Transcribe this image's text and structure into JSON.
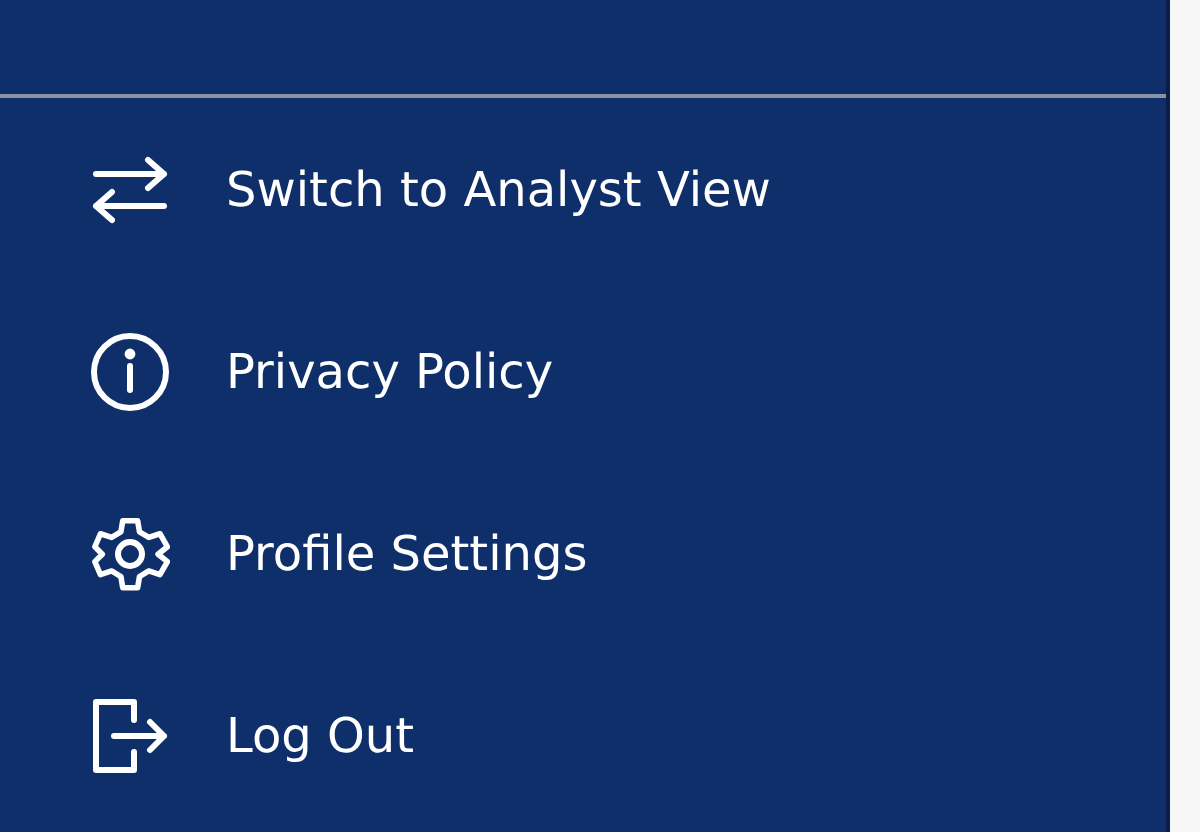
{
  "menu": {
    "items": [
      {
        "kind": "switch",
        "label": "Switch to Analyst View"
      },
      {
        "kind": "info",
        "label": "Privacy Policy"
      },
      {
        "kind": "settings",
        "label": "Profile Settings"
      },
      {
        "kind": "logout",
        "label": "Log Out"
      }
    ]
  }
}
